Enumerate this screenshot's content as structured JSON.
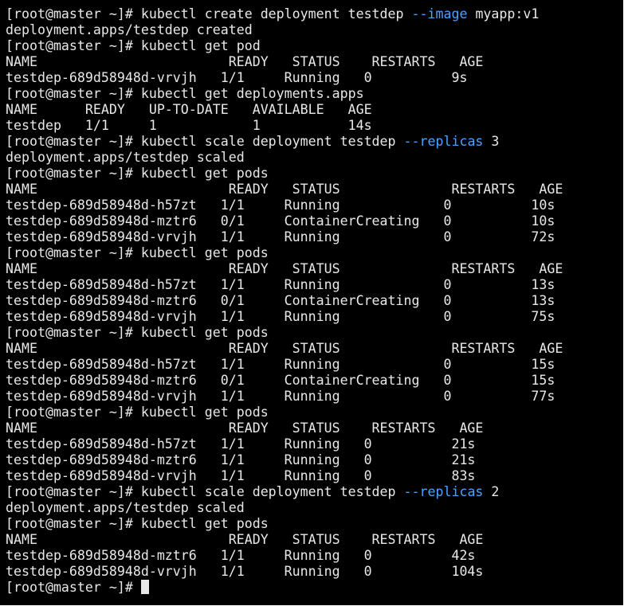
{
  "terminal": {
    "background": "#000000",
    "text_color": "#e8e8e8",
    "flag_color": "#4aa3ff",
    "prompt": "[root@master ~]# ",
    "lines": [
      {
        "kind": "command",
        "parts": [
          {
            "text": "[root@master ~]# kubectl create deployment testdep "
          },
          {
            "text": "--image",
            "flag": true
          },
          {
            "text": " myapp:v1"
          }
        ]
      },
      {
        "kind": "output",
        "parts": [
          {
            "text": "deployment.apps/testdep created"
          }
        ]
      },
      {
        "kind": "command",
        "parts": [
          {
            "text": "[root@master ~]# kubectl get pod"
          }
        ]
      },
      {
        "kind": "output",
        "parts": [
          {
            "text": "NAME                        READY   STATUS    RESTARTS   AGE"
          }
        ]
      },
      {
        "kind": "output",
        "parts": [
          {
            "text": "testdep-689d58948d-vrvjh   1/1     Running   0          9s"
          }
        ]
      },
      {
        "kind": "command",
        "parts": [
          {
            "text": "[root@master ~]# kubectl get deployments.apps"
          }
        ]
      },
      {
        "kind": "output",
        "parts": [
          {
            "text": "NAME      READY   UP-TO-DATE   AVAILABLE   AGE"
          }
        ]
      },
      {
        "kind": "output",
        "parts": [
          {
            "text": "testdep   1/1     1            1           14s"
          }
        ]
      },
      {
        "kind": "command",
        "parts": [
          {
            "text": "[root@master ~]# kubectl scale deployment testdep "
          },
          {
            "text": "--replicas",
            "flag": true
          },
          {
            "text": " 3"
          }
        ]
      },
      {
        "kind": "output",
        "parts": [
          {
            "text": "deployment.apps/testdep scaled"
          }
        ]
      },
      {
        "kind": "command",
        "parts": [
          {
            "text": "[root@master ~]# kubectl get pods"
          }
        ]
      },
      {
        "kind": "output",
        "parts": [
          {
            "text": "NAME                        READY   STATUS              RESTARTS   AGE"
          }
        ]
      },
      {
        "kind": "output",
        "parts": [
          {
            "text": "testdep-689d58948d-h57zt   1/1     Running             0          10s"
          }
        ]
      },
      {
        "kind": "output",
        "parts": [
          {
            "text": "testdep-689d58948d-mztr6   0/1     ContainerCreating   0          10s"
          }
        ]
      },
      {
        "kind": "output",
        "parts": [
          {
            "text": "testdep-689d58948d-vrvjh   1/1     Running             0          72s"
          }
        ]
      },
      {
        "kind": "command",
        "parts": [
          {
            "text": "[root@master ~]# kubectl get pods"
          }
        ]
      },
      {
        "kind": "output",
        "parts": [
          {
            "text": "NAME                        READY   STATUS              RESTARTS   AGE"
          }
        ]
      },
      {
        "kind": "output",
        "parts": [
          {
            "text": "testdep-689d58948d-h57zt   1/1     Running             0          13s"
          }
        ]
      },
      {
        "kind": "output",
        "parts": [
          {
            "text": "testdep-689d58948d-mztr6   0/1     ContainerCreating   0          13s"
          }
        ]
      },
      {
        "kind": "output",
        "parts": [
          {
            "text": "testdep-689d58948d-vrvjh   1/1     Running             0          75s"
          }
        ]
      },
      {
        "kind": "command",
        "parts": [
          {
            "text": "[root@master ~]# kubectl get pods"
          }
        ]
      },
      {
        "kind": "output",
        "parts": [
          {
            "text": "NAME                        READY   STATUS              RESTARTS   AGE"
          }
        ]
      },
      {
        "kind": "output",
        "parts": [
          {
            "text": "testdep-689d58948d-h57zt   1/1     Running             0          15s"
          }
        ]
      },
      {
        "kind": "output",
        "parts": [
          {
            "text": "testdep-689d58948d-mztr6   0/1     ContainerCreating   0          15s"
          }
        ]
      },
      {
        "kind": "output",
        "parts": [
          {
            "text": "testdep-689d58948d-vrvjh   1/1     Running             0          77s"
          }
        ]
      },
      {
        "kind": "command",
        "parts": [
          {
            "text": "[root@master ~]# kubectl get pods"
          }
        ]
      },
      {
        "kind": "output",
        "parts": [
          {
            "text": "NAME                        READY   STATUS    RESTARTS   AGE"
          }
        ]
      },
      {
        "kind": "output",
        "parts": [
          {
            "text": "testdep-689d58948d-h57zt   1/1     Running   0          21s"
          }
        ]
      },
      {
        "kind": "output",
        "parts": [
          {
            "text": "testdep-689d58948d-mztr6   1/1     Running   0          21s"
          }
        ]
      },
      {
        "kind": "output",
        "parts": [
          {
            "text": "testdep-689d58948d-vrvjh   1/1     Running   0          83s"
          }
        ]
      },
      {
        "kind": "command",
        "parts": [
          {
            "text": "[root@master ~]# kubectl scale deployment testdep "
          },
          {
            "text": "--replicas",
            "flag": true
          },
          {
            "text": " 2"
          }
        ]
      },
      {
        "kind": "output",
        "parts": [
          {
            "text": "deployment.apps/testdep scaled"
          }
        ]
      },
      {
        "kind": "command",
        "parts": [
          {
            "text": "[root@master ~]# kubectl get pods"
          }
        ]
      },
      {
        "kind": "output",
        "parts": [
          {
            "text": "NAME                        READY   STATUS    RESTARTS   AGE"
          }
        ]
      },
      {
        "kind": "output",
        "parts": [
          {
            "text": "testdep-689d58948d-mztr6   1/1     Running   0          42s"
          }
        ]
      },
      {
        "kind": "output",
        "parts": [
          {
            "text": "testdep-689d58948d-vrvjh   1/1     Running   0          104s"
          }
        ]
      }
    ]
  }
}
